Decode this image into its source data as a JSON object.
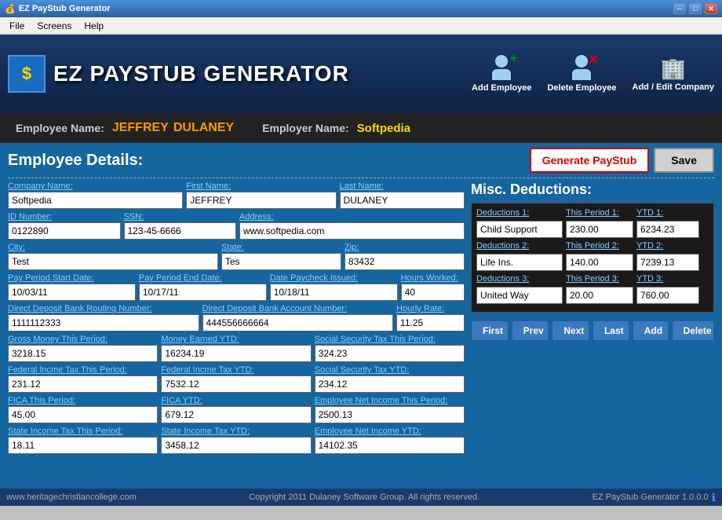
{
  "titleBar": {
    "title": "EZ PayStub Generator",
    "minBtn": "─",
    "maxBtn": "□",
    "closeBtn": "✕"
  },
  "menuBar": {
    "items": [
      "File",
      "Screens",
      "Help"
    ]
  },
  "header": {
    "logoSymbol": "$",
    "logoText": "EZ PAYSTUB GENERATOR",
    "actions": [
      {
        "label": "Add Employee",
        "icon": "👤"
      },
      {
        "label": "Delete Employee",
        "icon": "👤"
      },
      {
        "label": "Add / Edit Company",
        "icon": "🏢"
      }
    ]
  },
  "empNameBar": {
    "nameLabel": "Employee Name:",
    "firstName": "JEFFREY",
    "lastName": "DULANEY",
    "employerLabel": "Employer Name:",
    "employerName": "Softpedia"
  },
  "employeeDetails": {
    "title": "Employee Details:",
    "generateBtn": "Generate PayStub",
    "saveBtn": "Save"
  },
  "form": {
    "companyName": {
      "label": "Company Name:",
      "value": "Softpedia"
    },
    "firstName": {
      "label": "First Name:",
      "value": "JEFFREY"
    },
    "lastName": {
      "label": "Last Name:",
      "value": "DULANEY"
    },
    "idNumber": {
      "label": "ID Number:",
      "value": "0122890"
    },
    "ssn": {
      "label": "SSN:",
      "value": "123-45-6666"
    },
    "address": {
      "label": "Address:",
      "value": "www.softpedia.com"
    },
    "city": {
      "label": "City:",
      "value": "Test"
    },
    "state": {
      "label": "State:",
      "value": "Tes"
    },
    "zip": {
      "label": "Zip:",
      "value": "83432"
    },
    "payPeriodStart": {
      "label": "Pay Period Start Date:",
      "value": "10/03/11"
    },
    "payPeriodEnd": {
      "label": "Pay Period End Date:",
      "value": "10/17/11"
    },
    "paycheckDate": {
      "label": "Date Paycheck Issued:",
      "value": "10/18/11"
    },
    "hoursWorked": {
      "label": "Hours Worked:",
      "value": "40"
    },
    "bankRouting": {
      "label": "Direct Deposit Bank Routing Number:",
      "value": "1111112333"
    },
    "bankAccount": {
      "label": "Direct Deposit Bank Account Number:",
      "value": "444556666664"
    },
    "hourlyRate": {
      "label": "Hourly Rate:",
      "value": "11.25"
    },
    "grossMoney": {
      "label": "Gross Money This Period:",
      "value": "3218.15"
    },
    "moneyYTD": {
      "label": "Money Earned YTD:",
      "value": "16234.19"
    },
    "ssTaxPeriod": {
      "label": "Social Security Tax This Period:",
      "value": "324.23"
    },
    "fedIncomePeriod": {
      "label": "Federal Incme Tax This Period:",
      "value": "231.12"
    },
    "fedIncomeYTD": {
      "label": "Federal Incme Tax YTD:",
      "value": "7532.12"
    },
    "ssTaxYTD": {
      "label": "Social Security Tax YTD:",
      "value": "234.12"
    },
    "ficaPeriod": {
      "label": "FICA This Period:",
      "value": "45.00"
    },
    "ficaYTD": {
      "label": "FICA YTD:",
      "value": "679.12"
    },
    "empNetIncomePeriod": {
      "label": "Employee Net Income This Period:",
      "value": "2500.13"
    },
    "stateIncomePeriod": {
      "label": "State Income Tax This Period:",
      "value": "18.11"
    },
    "stateIncomeYTD": {
      "label": "State Income Tax YTD:",
      "value": "3458.12"
    },
    "empNetIncomeYTD": {
      "label": "Employee Net Income YTD:",
      "value": "14102.35"
    }
  },
  "miscDeductions": {
    "title": "Misc. Deductions:",
    "headers": {
      "deduction": "Deductions",
      "thisPeriod": "This Period",
      "ytd": "YTD"
    },
    "rows": [
      {
        "numLabel": "Deductions 1:",
        "periodLabel": "This Period 1:",
        "ytdLabel": "YTD 1:",
        "name": "Child Support",
        "period": "230.00",
        "ytd": "6234.23"
      },
      {
        "numLabel": "Deductions 2:",
        "periodLabel": "This Period 2:",
        "ytdLabel": "YTD 2:",
        "name": "Life Ins.",
        "period": "140.00",
        "ytd": "7239.13"
      },
      {
        "numLabel": "Deductions 3:",
        "periodLabel": "This Period 3:",
        "ytdLabel": "YTD 3:",
        "name": "United Way",
        "period": "20.00",
        "ytd": "760.00"
      }
    ]
  },
  "navButtons": {
    "first": "First",
    "prev": "Prev",
    "next": "Next",
    "last": "Last",
    "add": "Add",
    "delete": "Delete"
  },
  "footer": {
    "left": "www.heritagechristiancollege.com",
    "copyright": "Copyright 2011 Dulaney Software Group. All rights reserved.",
    "version": "EZ PayStub Generator 1.0.0.0",
    "infoIcon": "ℹ"
  }
}
